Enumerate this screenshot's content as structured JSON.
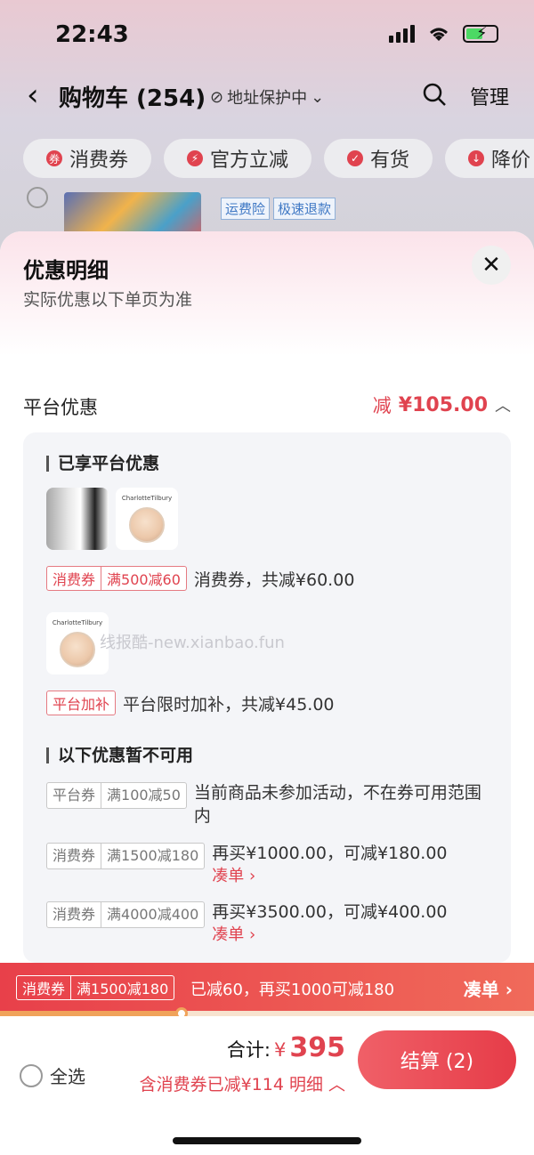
{
  "status": {
    "time": "22:43"
  },
  "nav": {
    "title": "购物车 (254)",
    "address": "地址保护中",
    "manage": "管理"
  },
  "chips": [
    {
      "label": "消费券"
    },
    {
      "label": "官方立减"
    },
    {
      "label": "有货"
    },
    {
      "label": "降价"
    }
  ],
  "bg_row": {
    "tags": [
      "运费险",
      "极速退款"
    ]
  },
  "sheet": {
    "title": "优惠明细",
    "subtitle": "实际优惠以下单页为准",
    "section_label": "平台优惠",
    "section_amount_prefix": "减",
    "section_amount": "¥105.00",
    "enjoyed_title": "已享平台优惠",
    "promo1": {
      "tag_a": "消费券",
      "tag_b": "满500减60",
      "text": "消费券，共减¥60.00"
    },
    "promo2": {
      "tag_a": "平台加补",
      "text": "平台限时加补，共减¥45.00"
    },
    "unavailable_title": "以下优惠暂不可用",
    "unavailable": [
      {
        "tag_a": "平台券",
        "tag_b": "满100减50",
        "text": "当前商品未参加活动，不在券可用范围内",
        "link": ""
      },
      {
        "tag_a": "消费券",
        "tag_b": "满1500减180",
        "text": "再买¥1000.00，可减¥180.00",
        "link": "凑单 ›"
      },
      {
        "tag_a": "消费券",
        "tag_b": "满4000减400",
        "text": "再买¥3500.00，可减¥400.00",
        "link": "凑单 ›"
      }
    ],
    "thumb_brand": "CharlotteTilbury",
    "watermark": "线报酷-new.xianbao.fun"
  },
  "banner": {
    "tag_a": "消费券",
    "tag_b": "满1500减180",
    "text": "已减60，再买1000可减180",
    "cta": "凑单 ›",
    "progress": 0.34
  },
  "footer": {
    "select_all": "全选",
    "total_label": "合计:",
    "currency": "¥",
    "total": "395",
    "discount_note": "含消费券已减¥114 明细 ︿",
    "checkout": "结算 (2)"
  },
  "colors": {
    "accent": "#e0434f",
    "progress": "#f0a35a"
  }
}
